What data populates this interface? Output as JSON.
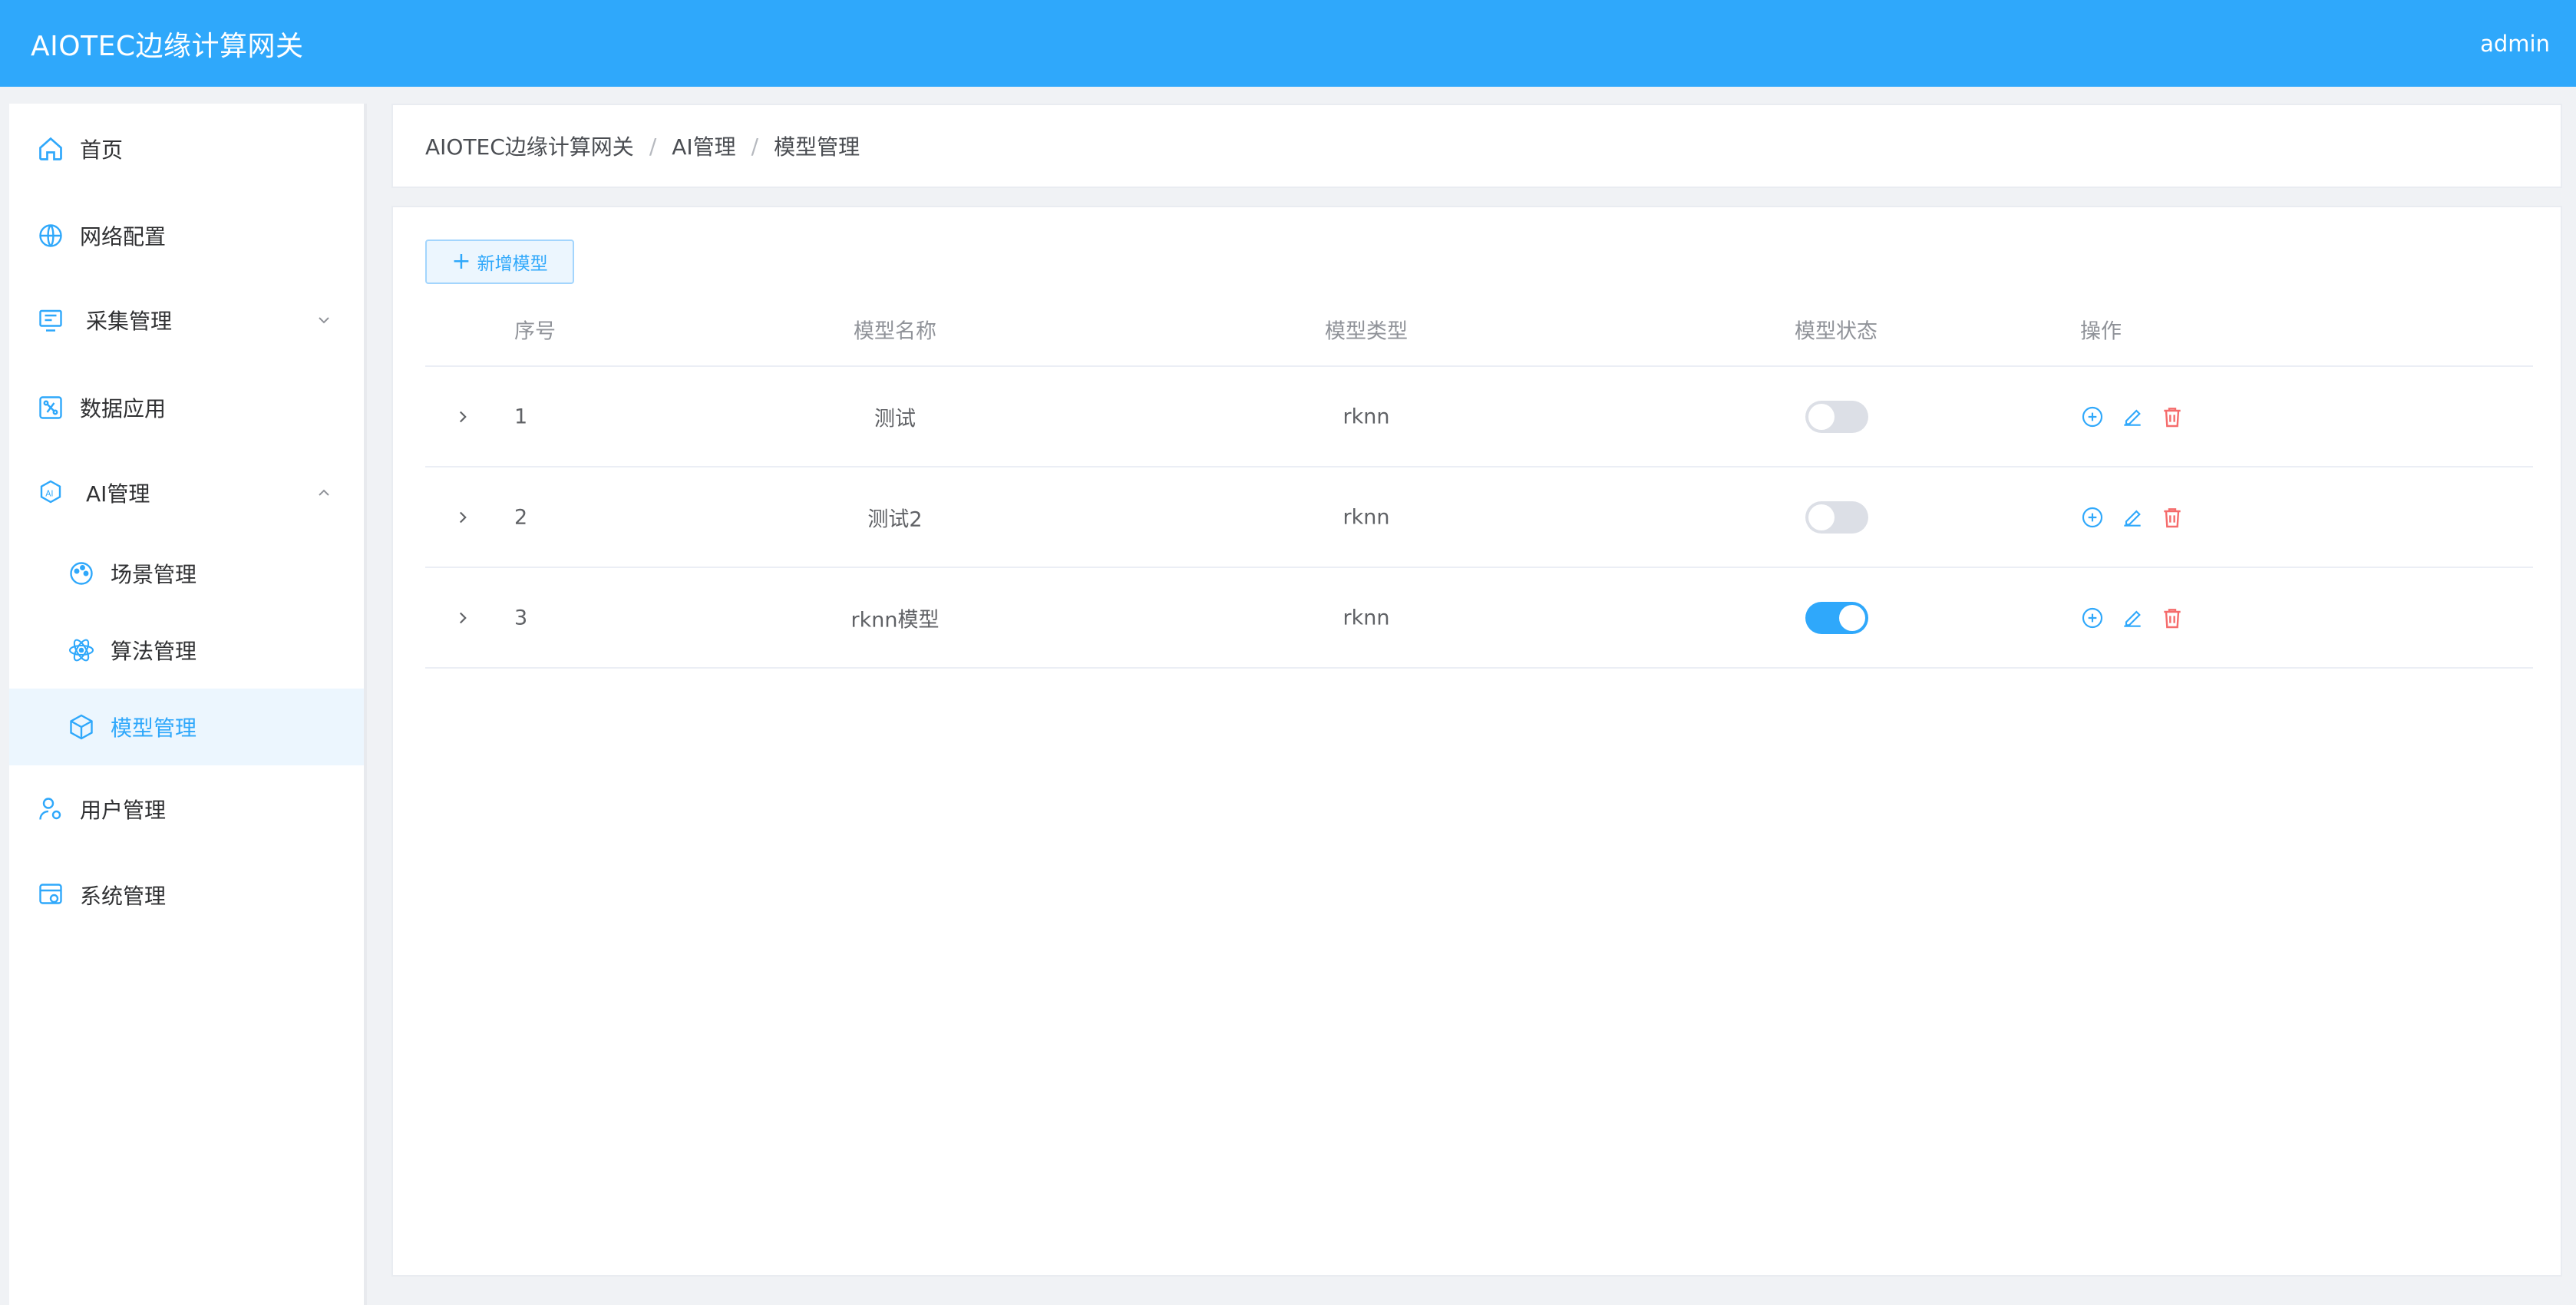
{
  "header": {
    "title": "AIOTEC边缘计算网关",
    "user": "admin"
  },
  "sidebar": {
    "items": [
      {
        "label": "首页",
        "icon": "home-icon"
      },
      {
        "label": "网络配置",
        "icon": "globe-icon"
      },
      {
        "label": "采集管理",
        "icon": "monitor-icon",
        "expanded": false
      },
      {
        "label": "数据应用",
        "icon": "data-app-icon"
      },
      {
        "label": "AI管理",
        "icon": "ai-icon",
        "expanded": true
      },
      {
        "label": "场景管理",
        "icon": "palette-icon"
      },
      {
        "label": "算法管理",
        "icon": "atom-icon"
      },
      {
        "label": "模型管理",
        "icon": "cube-icon",
        "active": true
      },
      {
        "label": "用户管理",
        "icon": "user-gear-icon"
      },
      {
        "label": "系统管理",
        "icon": "system-settings-icon"
      }
    ]
  },
  "breadcrumb": [
    "AIOTEC边缘计算网关",
    "AI管理",
    "模型管理"
  ],
  "toolbar": {
    "add_label": "新增模型",
    "add_icon": "+"
  },
  "table": {
    "columns": [
      "序号",
      "模型名称",
      "模型类型",
      "模型状态",
      "操作"
    ],
    "rows": [
      {
        "no": "1",
        "name": "测试",
        "type": "rknn",
        "status_on": false
      },
      {
        "no": "2",
        "name": "测试2",
        "type": "rknn",
        "status_on": false
      },
      {
        "no": "3",
        "name": "rknn模型",
        "type": "rknn",
        "status_on": true
      }
    ]
  },
  "colors": {
    "primary": "#2fa8fb",
    "danger": "#f56c6c",
    "active_bg": "#ecf6fe"
  }
}
